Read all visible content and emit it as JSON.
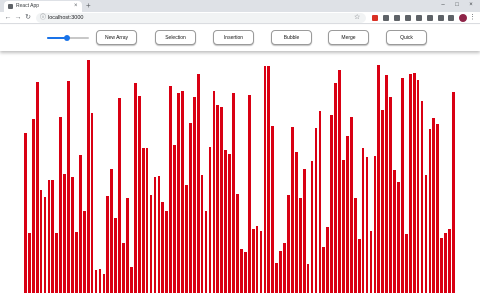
{
  "browser": {
    "tab_title": "React App",
    "tab_close": "×",
    "new_tab": "+",
    "url": "localhost:3000",
    "controls": {
      "minimize": "–",
      "maximize": "□",
      "close": "×"
    }
  },
  "toolbar_icons": {
    "back": "←",
    "forward": "→",
    "reload": "↻",
    "info": "ⓘ",
    "star": "☆",
    "menu": "⋮"
  },
  "extension_colors": [
    "#d93025",
    "#5f6368",
    "#5f6368",
    "#5f6368",
    "#5f6368",
    "#5f6368",
    "#5f6368",
    "#5f6368"
  ],
  "array_size_slider": {
    "fraction": 0.48
  },
  "buttons": {
    "new_array": "New Array",
    "selection": "Selection",
    "insertion": "Insertion",
    "bubble": "Bubble",
    "merge": "Merge",
    "quick": "Quick"
  },
  "colors": {
    "bar": "#d90013",
    "slider": "#1a73e8"
  },
  "bar_values": [
    160,
    60,
    174,
    211,
    103,
    96,
    113,
    113,
    60,
    176,
    119,
    212,
    116,
    61,
    138,
    82,
    233,
    180,
    23,
    24,
    19,
    97,
    124,
    75,
    195,
    50,
    95,
    26,
    210,
    197,
    145,
    145,
    98,
    116,
    117,
    91,
    82,
    207,
    148,
    200,
    202,
    108,
    170,
    196,
    219,
    118,
    82,
    146,
    202,
    188,
    186,
    143,
    139,
    200,
    99,
    44,
    41,
    198,
    64,
    67,
    62,
    227,
    227,
    167,
    30,
    42,
    50,
    98,
    166,
    141,
    95,
    124,
    29,
    132,
    165,
    182,
    46,
    66,
    178,
    210,
    223,
    133,
    157,
    176,
    95,
    54,
    145,
    136,
    62,
    137,
    228,
    183,
    218,
    196,
    123,
    111,
    215,
    59,
    219,
    220,
    213,
    192,
    118,
    164,
    175,
    169,
    55,
    60,
    64,
    201
  ]
}
